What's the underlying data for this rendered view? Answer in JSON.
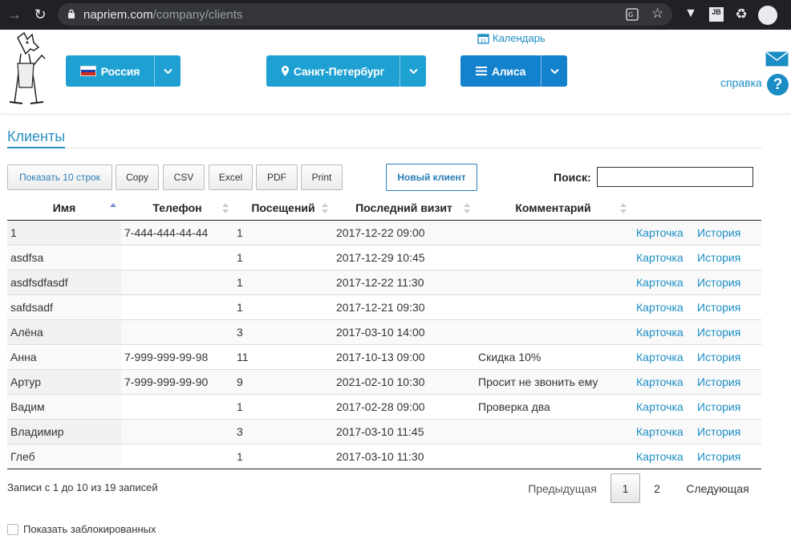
{
  "browser": {
    "url_domain": "napriem.com",
    "url_path": "/company/clients",
    "extension_jb": "JB"
  },
  "header": {
    "country_label": "Россия",
    "city_label": "Санкт-Петербург",
    "user_label": "Алиса",
    "calendar_label": "Календарь",
    "calendar_day": "31",
    "help_label": "справка",
    "help_icon": "?"
  },
  "page": {
    "title": "Клиенты"
  },
  "toolbar": {
    "length_label": "Показать 10 строк",
    "copy_label": "Copy",
    "csv_label": "CSV",
    "excel_label": "Excel",
    "pdf_label": "PDF",
    "print_label": "Print",
    "new_client_label": "Новый клиент",
    "search_label": "Поиск:",
    "search_value": ""
  },
  "table": {
    "columns": [
      "Имя",
      "Телефон",
      "Посещений",
      "Последний визит",
      "Комментарий"
    ],
    "card_label": "Карточка",
    "history_label": "История",
    "rows": [
      {
        "name": "1",
        "phone": "7-444-444-44-44",
        "visits": "1",
        "last": "2017-12-22 09:00",
        "comment": ""
      },
      {
        "name": "asdfsa",
        "phone": "",
        "visits": "1",
        "last": "2017-12-29 10:45",
        "comment": ""
      },
      {
        "name": "asdfsdfasdf",
        "phone": "",
        "visits": "1",
        "last": "2017-12-22 11:30",
        "comment": ""
      },
      {
        "name": "safdsadf",
        "phone": "",
        "visits": "1",
        "last": "2017-12-21 09:30",
        "comment": ""
      },
      {
        "name": "Алёна",
        "phone": "",
        "visits": "3",
        "last": "2017-03-10 14:00",
        "comment": ""
      },
      {
        "name": "Анна",
        "phone": "7-999-999-99-98",
        "visits": "11",
        "last": "2017-10-13 09:00",
        "comment": "Скидка 10%"
      },
      {
        "name": "Артур",
        "phone": "7-999-999-99-90",
        "visits": "9",
        "last": "2021-02-10 10:30",
        "comment": "Просит не звонить ему"
      },
      {
        "name": "Вадим",
        "phone": "",
        "visits": "1",
        "last": "2017-02-28 09:00",
        "comment": "Проверка два"
      },
      {
        "name": "Владимир",
        "phone": "",
        "visits": "3",
        "last": "2017-03-10 11:45",
        "comment": ""
      },
      {
        "name": "Глеб",
        "phone": "",
        "visits": "1",
        "last": "2017-03-10 11:30",
        "comment": ""
      }
    ]
  },
  "footer": {
    "info": "Записи с 1 до 10 из 19 записей",
    "prev_label": "Предыдущая",
    "pages": [
      "1",
      "2"
    ],
    "next_label": "Следующая",
    "show_blocked_label": "Показать заблокированных"
  },
  "colors": {
    "primary": "#1ea1d2",
    "primary_dark": "#1481cd",
    "link": "#1a8dc4"
  }
}
